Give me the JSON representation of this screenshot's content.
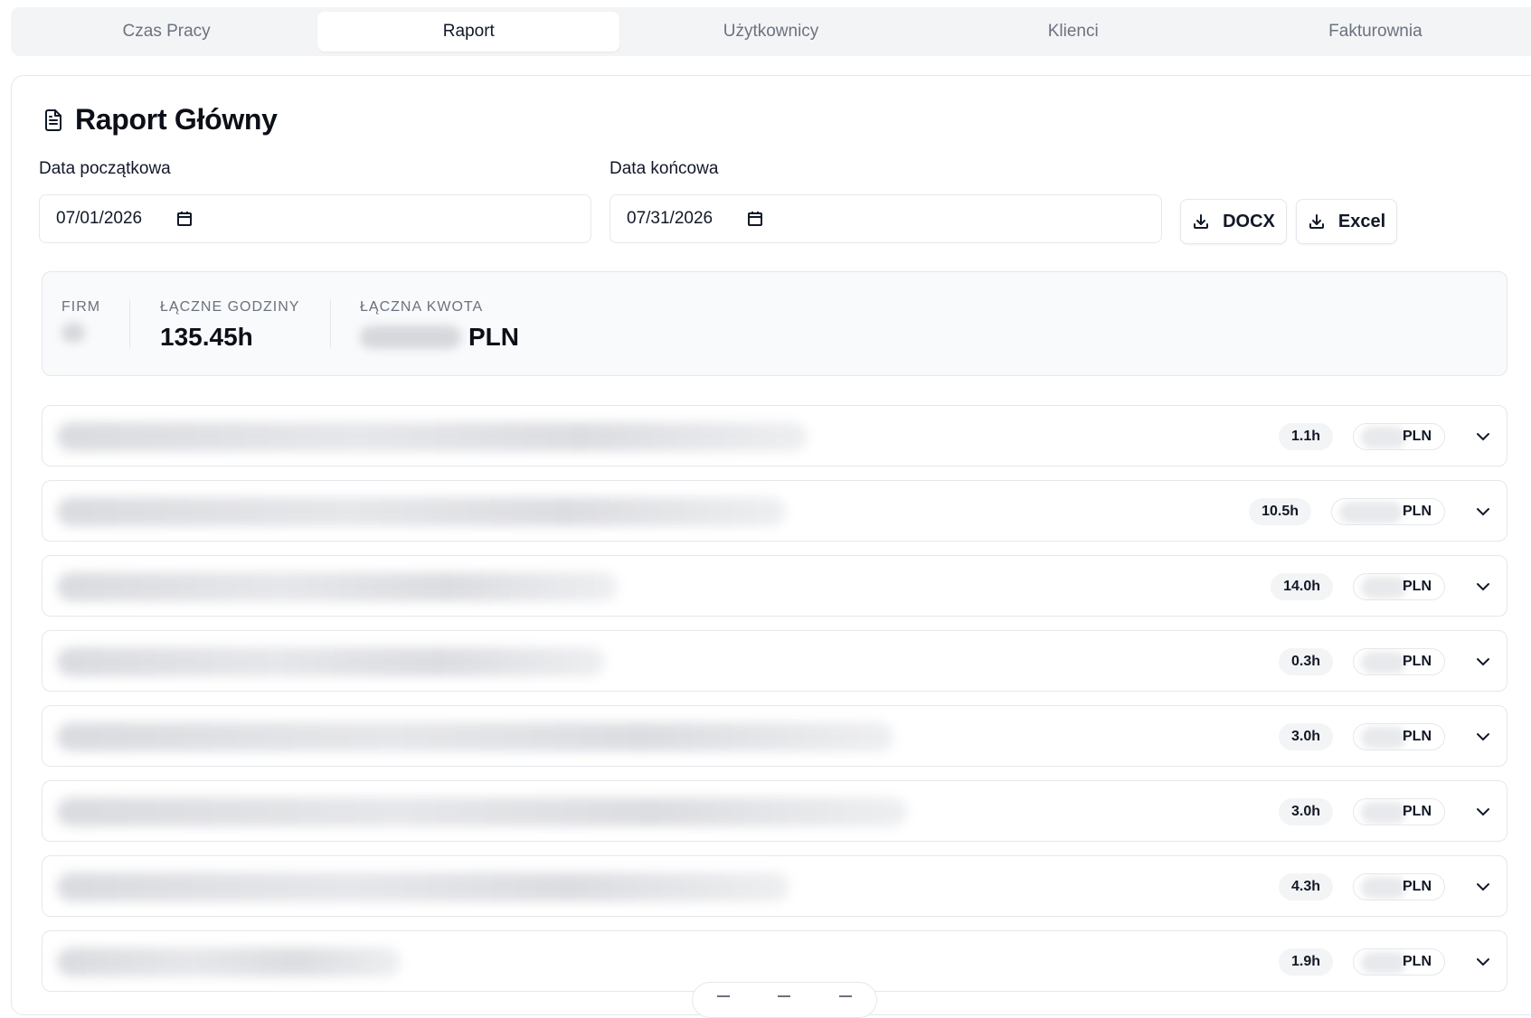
{
  "tabs": [
    {
      "label": "Czas Pracy",
      "active": false
    },
    {
      "label": "Raport",
      "active": true
    },
    {
      "label": "Użytkownicy",
      "active": false
    },
    {
      "label": "Klienci",
      "active": false
    },
    {
      "label": "Fakturownia",
      "active": false
    }
  ],
  "report": {
    "title": "Raport Główny",
    "start_label": "Data początkowa",
    "start_value": "07/01/2026",
    "end_label": "Data końcowa",
    "end_value": "07/31/2026",
    "docx_label": "DOCX",
    "excel_label": "Excel"
  },
  "summary": {
    "firm_caption": "FIRM",
    "hours_caption": "ŁĄCZNE GODZINY",
    "hours_value": "135.45h",
    "amount_caption": "ŁĄCZNA KWOTA",
    "amount_currency": "PLN"
  },
  "rows": [
    {
      "hours": "1.1h",
      "currency": "PLN"
    },
    {
      "hours": "10.5h",
      "currency": "PLN"
    },
    {
      "hours": "14.0h",
      "currency": "PLN"
    },
    {
      "hours": "0.3h",
      "currency": "PLN"
    },
    {
      "hours": "3.0h",
      "currency": "PLN"
    },
    {
      "hours": "3.0h",
      "currency": "PLN"
    },
    {
      "hours": "4.3h",
      "currency": "PLN"
    },
    {
      "hours": "1.9h",
      "currency": "PLN"
    }
  ],
  "icons": {
    "title": "file-text-icon",
    "calendar": "calendar-icon",
    "download": "download-icon",
    "expand": "chevron-down-icon"
  }
}
